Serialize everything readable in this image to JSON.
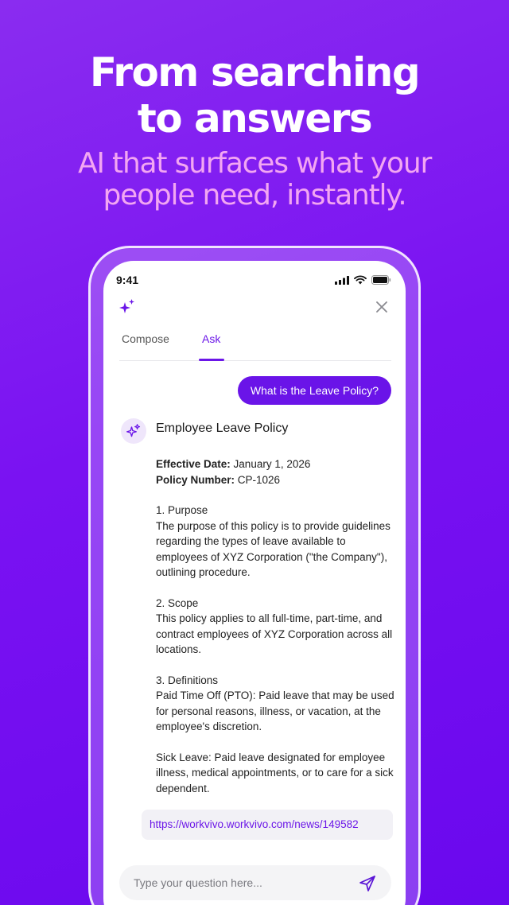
{
  "hero": {
    "headline_line1": "From searching",
    "headline_line2": "to answers",
    "subhead_line1": "AI that surfaces what your",
    "subhead_line2": "people need, instantly."
  },
  "status_bar": {
    "time": "9:41"
  },
  "tabs": [
    {
      "label": "Compose",
      "active": false
    },
    {
      "label": "Ask",
      "active": true
    }
  ],
  "chat": {
    "user_question": "What is the Leave Policy?",
    "answer_title": "Employee Leave Policy",
    "effective_label": "Effective Date:",
    "effective_value": " January 1, 2026",
    "policy_label": "Policy Number:",
    "policy_value": " CP-1026",
    "purpose_heading": "1. Purpose",
    "purpose_text": "The purpose of this policy is to provide guidelines regarding the types of leave available to employees of XYZ Corporation (\"the Company\"), outlining procedure.",
    "scope_heading": "2. Scope",
    "scope_text": "This policy applies to all full-time, part-time, and contract employees of XYZ Corporation across all locations.",
    "definitions_heading": "3. Definitions",
    "pto_text": "Paid Time Off (PTO): Paid leave that may be used for personal reasons, illness, or vacation, at the employee's discretion.",
    "sick_text": "Sick Leave: Paid leave designated for employee illness, medical appointments, or to care for a sick dependent.",
    "source_link": "https://workvivo.workvivo.com/news/149582"
  },
  "input": {
    "placeholder": "Type your question here..."
  },
  "colors": {
    "accent": "#6a14e8",
    "subhead": "#f3a6f2",
    "background": "#7a12f2"
  },
  "icons": [
    "sparkle-icon",
    "close-icon",
    "signal-icon",
    "wifi-icon",
    "battery-icon",
    "send-icon"
  ]
}
